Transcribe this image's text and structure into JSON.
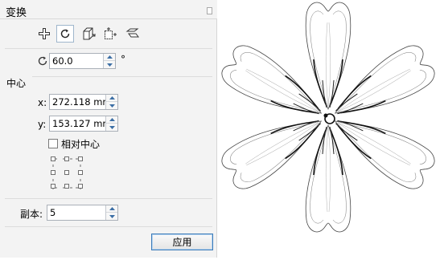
{
  "panel": {
    "title": "变换",
    "tools": [
      {
        "name": "position-icon",
        "active": false
      },
      {
        "name": "rotate-icon",
        "active": true
      },
      {
        "name": "scale-mirror-icon",
        "active": false
      },
      {
        "name": "size-icon",
        "active": false
      },
      {
        "name": "skew-icon",
        "active": false
      }
    ],
    "rotation": {
      "value": "60.0",
      "unit": "°"
    },
    "center": {
      "label": "中心",
      "x_label": "x:",
      "x_value": "272.118 mm",
      "y_label": "y:",
      "y_value": "153.127 mm",
      "relative_label": "相对中心",
      "relative_checked": false
    },
    "copies": {
      "label": "副本:",
      "value": "5"
    },
    "apply_label": "应用"
  },
  "canvas": {
    "subject": "flower-drawing",
    "petal_count": 6
  }
}
